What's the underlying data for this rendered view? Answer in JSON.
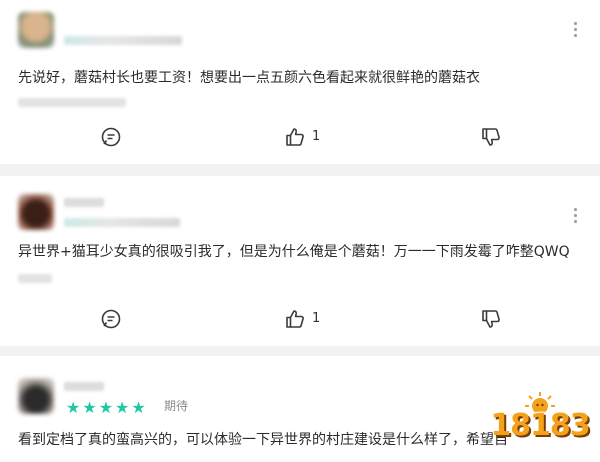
{
  "comments": [
    {
      "text": "先说好，蘑菇村长也要工资！想要出一点五颜六色看起来就很鲜艳的蘑菇衣",
      "likes": "1"
    },
    {
      "text": "异世界+猫耳少女真的很吸引我了，但是为什么俺是个蘑菇！万一一下雨发霉了咋整QWQ",
      "likes": "1"
    },
    {
      "text": "看到定档了真的蛮高兴的，可以体验一下异世界的村庄建设是什么样了，希望自",
      "rating_stars": 5,
      "rating_label": "期待"
    }
  ],
  "icons": {
    "reply": "reply-bubble-icon",
    "like": "thumbs-up-icon",
    "dislike": "thumbs-down-icon",
    "more": "more-vertical-icon"
  },
  "watermark": "18183",
  "colors": {
    "star": "#1fc8a5",
    "logo": "#f5a21b",
    "background": "#f2f2f2"
  }
}
